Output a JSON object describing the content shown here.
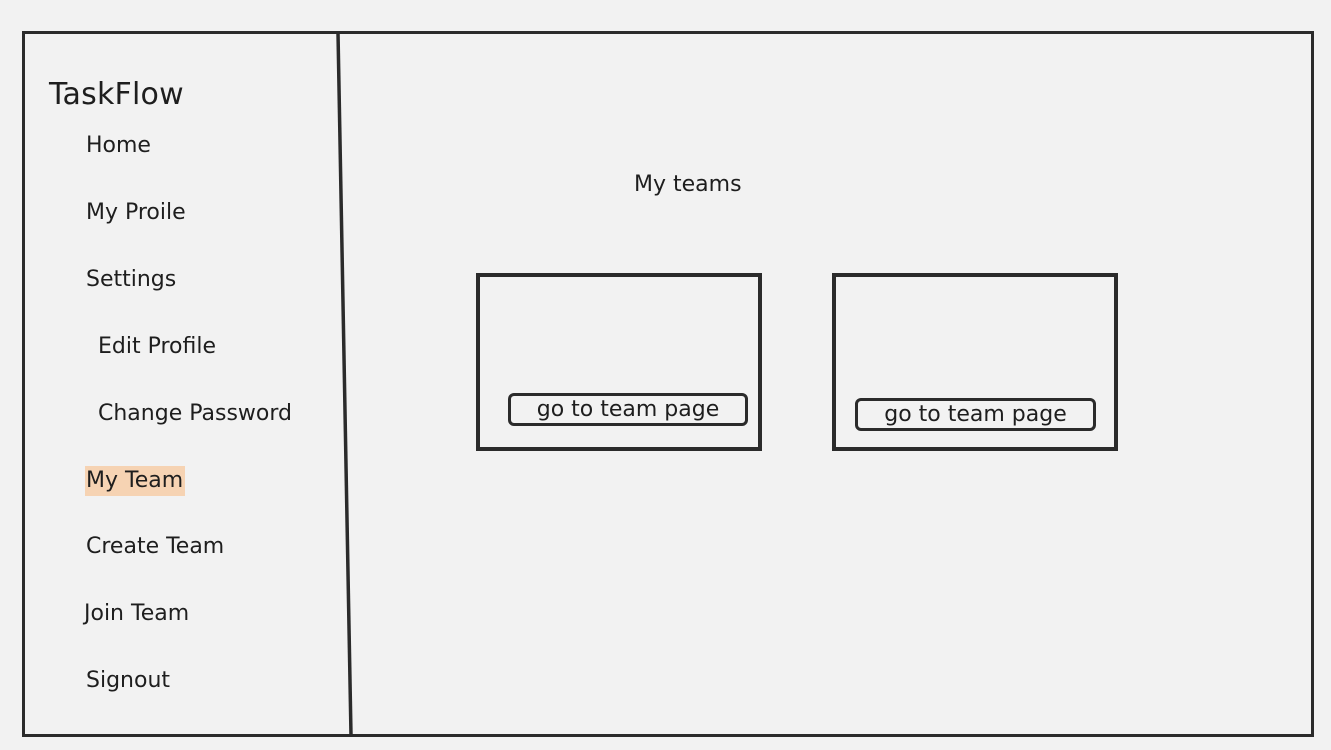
{
  "sidebar": {
    "brand": "TaskFlow",
    "items": [
      {
        "label": "Home",
        "active": false
      },
      {
        "label": "My Proile",
        "active": false
      },
      {
        "label": "Settings",
        "active": false
      },
      {
        "label": "Edit Profile",
        "active": false
      },
      {
        "label": "Change Password",
        "active": false
      },
      {
        "label": "My Team",
        "active": true
      },
      {
        "label": "Create Team",
        "active": false
      },
      {
        "label": "Join Team",
        "active": false
      },
      {
        "label": "Signout",
        "active": false
      }
    ]
  },
  "main": {
    "title": "My teams",
    "teams": [
      {
        "button_label": "go to team page"
      },
      {
        "button_label": "go to team page"
      }
    ]
  },
  "colors": {
    "active_highlight": "#f6d3b3",
    "border": "#2b2b2b",
    "background": "#f2f2f2"
  }
}
